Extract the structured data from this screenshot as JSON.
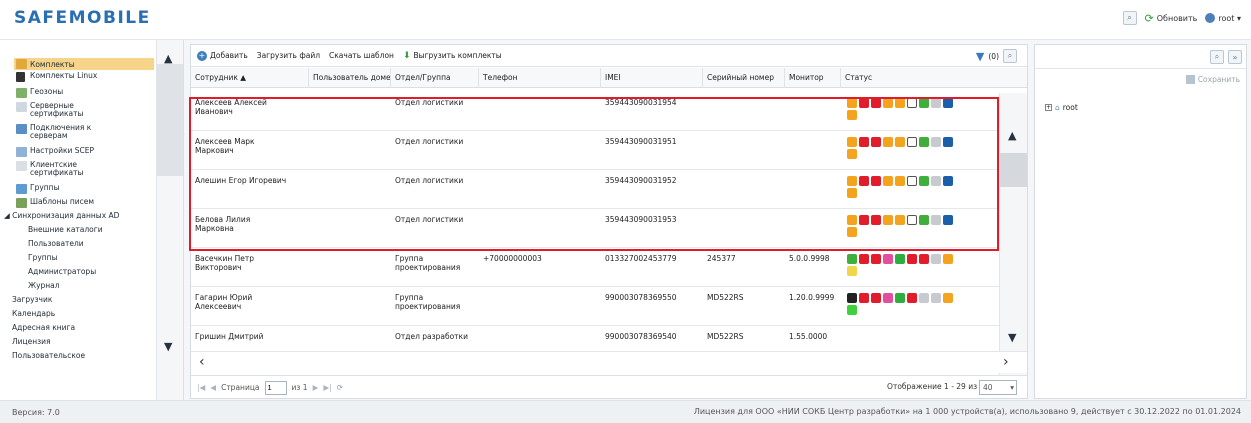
{
  "app": {
    "logo": "SAFEMOBILE"
  },
  "header": {
    "refresh_label": "Обновить",
    "user_label": "root ▾"
  },
  "sidebar": {
    "items": [
      {
        "label": "Комплекты",
        "selected": true
      },
      {
        "label": "Комплекты Linux"
      },
      {
        "label": "Геозоны"
      },
      {
        "label": "Серверные\nсертификаты"
      },
      {
        "label": "Подключения к\nсерверам"
      },
      {
        "label": "Настройки SCEP"
      },
      {
        "label": "Клиентские\nсертификаты"
      },
      {
        "label": "Группы"
      },
      {
        "label": "Шаблоны писем"
      },
      {
        "label": "◢ Синхронизация данных AD"
      },
      {
        "label": "Внешние каталоги"
      },
      {
        "label": "Пользователи"
      },
      {
        "label": "Группы"
      },
      {
        "label": "Администраторы"
      },
      {
        "label": "Журнал"
      },
      {
        "label": "Загрузчик"
      },
      {
        "label": "Календарь"
      },
      {
        "label": "Адресная книга"
      },
      {
        "label": "Лицензия"
      },
      {
        "label": "Пользовательское"
      }
    ]
  },
  "toolbar": {
    "add_label": "Добавить",
    "upload_label": "Загрузить файл",
    "template_label": "Скачать шаблон",
    "export_label": "Выгрузить комплекты",
    "filter_count": "(0)"
  },
  "grid": {
    "columns": [
      "Сотрудник ▲",
      "Пользователь доме",
      "Отдел/Группа",
      "Телефон",
      "IMEI",
      "Серийный номер",
      "Монитор",
      "Статус"
    ],
    "rows": [
      {
        "employee": "Алексеев Алексей\nИванович",
        "user": "",
        "dept": "Отдел логистики",
        "phone": "",
        "imei": "359443090031954",
        "serial": "",
        "monitor": ""
      },
      {
        "employee": "Алексеев Марк\nМаркович",
        "user": "",
        "dept": "Отдел логистики",
        "phone": "",
        "imei": "359443090031951",
        "serial": "",
        "monitor": ""
      },
      {
        "employee": "Алешин Егор Игоревич",
        "user": "",
        "dept": "Отдел логистики",
        "phone": "",
        "imei": "359443090031952",
        "serial": "",
        "monitor": ""
      },
      {
        "employee": "Белова Лилия\nМарковна",
        "user": "",
        "dept": "Отдел логистики",
        "phone": "",
        "imei": "359443090031953",
        "serial": "",
        "monitor": ""
      },
      {
        "employee": "Васечкин Петр\nВикторович",
        "user": "",
        "dept": "Группа проектирования",
        "phone": "+70000000003",
        "imei": "013327002453779",
        "serial": "245377",
        "monitor": "5.0.0.9998"
      },
      {
        "employee": "Гагарин Юрий\nАлексеевич",
        "user": "",
        "dept": "Группа проектирования",
        "phone": "",
        "imei": "990003078369550",
        "serial": "MD522RS",
        "monitor": "1.20.0.9999"
      },
      {
        "employee": "Гришин Дмитрий",
        "user": "",
        "dept": "Отдел разработки",
        "phone": "",
        "imei": "990003078369540",
        "serial": "MD522RS",
        "monitor": "1.55.0000"
      }
    ]
  },
  "pager": {
    "page_label": "Страница",
    "page_value": "1",
    "of_label": "из 1",
    "info": "Отображение 1 - 29 из 29",
    "page_size": "40"
  },
  "right_panel": {
    "save_label": "Сохранить",
    "tree_root": "root"
  },
  "footer": {
    "version": "Версия: 7.0",
    "license": "Лицензия для ООО «НИИ СОКБ Центр разработки» на 1 000 устройств(а), использовано 9, действует с 30.12.2022 по 01.01.2024"
  }
}
